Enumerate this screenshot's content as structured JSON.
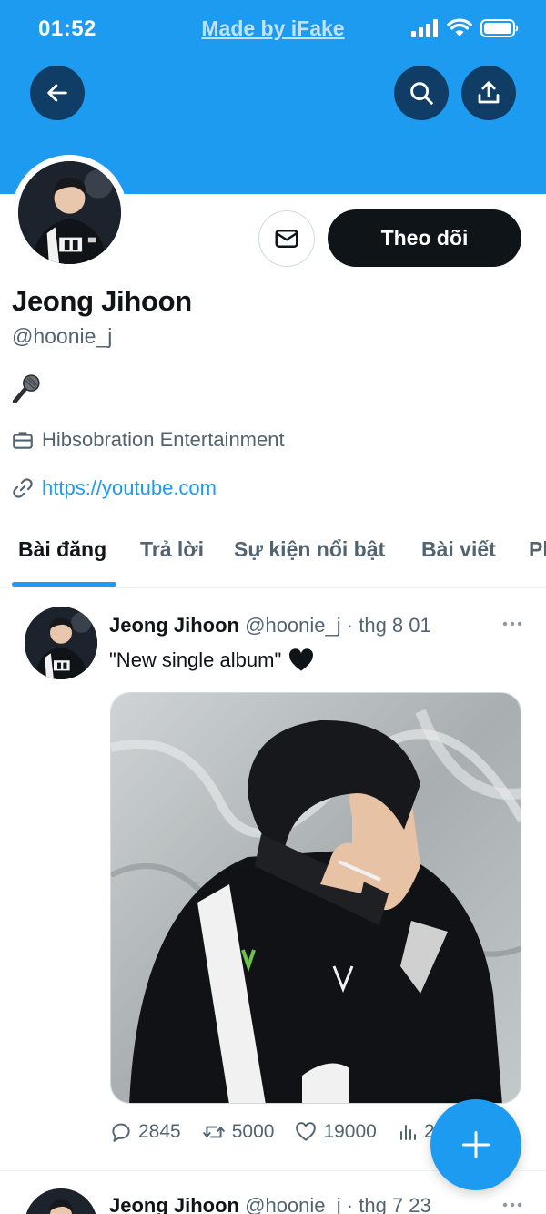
{
  "status_bar": {
    "time": "01:52",
    "center_text": "Made by iFake"
  },
  "icons": {
    "back": "arrow-left-icon",
    "search": "search-icon",
    "share": "share-icon",
    "message": "mail-icon",
    "bio": "microphone-icon",
    "company": "briefcase-icon",
    "link": "link-icon",
    "more": "more-horizontal-icon",
    "reply": "reply-icon",
    "retweet": "retweet-icon",
    "like": "heart-icon",
    "views": "analytics-icon",
    "compose": "plus-icon"
  },
  "colors": {
    "accent": "#1d9bf0",
    "text": "#0f1419",
    "secondary": "#536471",
    "dark_button": "#0f1419"
  },
  "profile": {
    "display_name": "Jeong Jihoon",
    "handle": "@hoonie_j",
    "follow_label": "Theo dõi",
    "company": "Hibsobration Entertainment",
    "link": "https://youtube.com"
  },
  "tabs": [
    "Bài đăng",
    "Trả lời",
    "Sự kiện nổi bật",
    "Bài viết",
    "Ph"
  ],
  "active_tab": 0,
  "posts": [
    {
      "name": "Jeong Jihoon",
      "handle": "@hoonie_j",
      "sep": " · ",
      "date": "thg 8 01",
      "text": "\"New single album\"",
      "reply_count": "2845",
      "retweet_count": "5000",
      "like_count": "19000",
      "view_count": "2"
    },
    {
      "name": "Jeong Jihoon",
      "handle": "@hoonie_j",
      "sep": " · ",
      "date": "thg 7 23"
    }
  ]
}
